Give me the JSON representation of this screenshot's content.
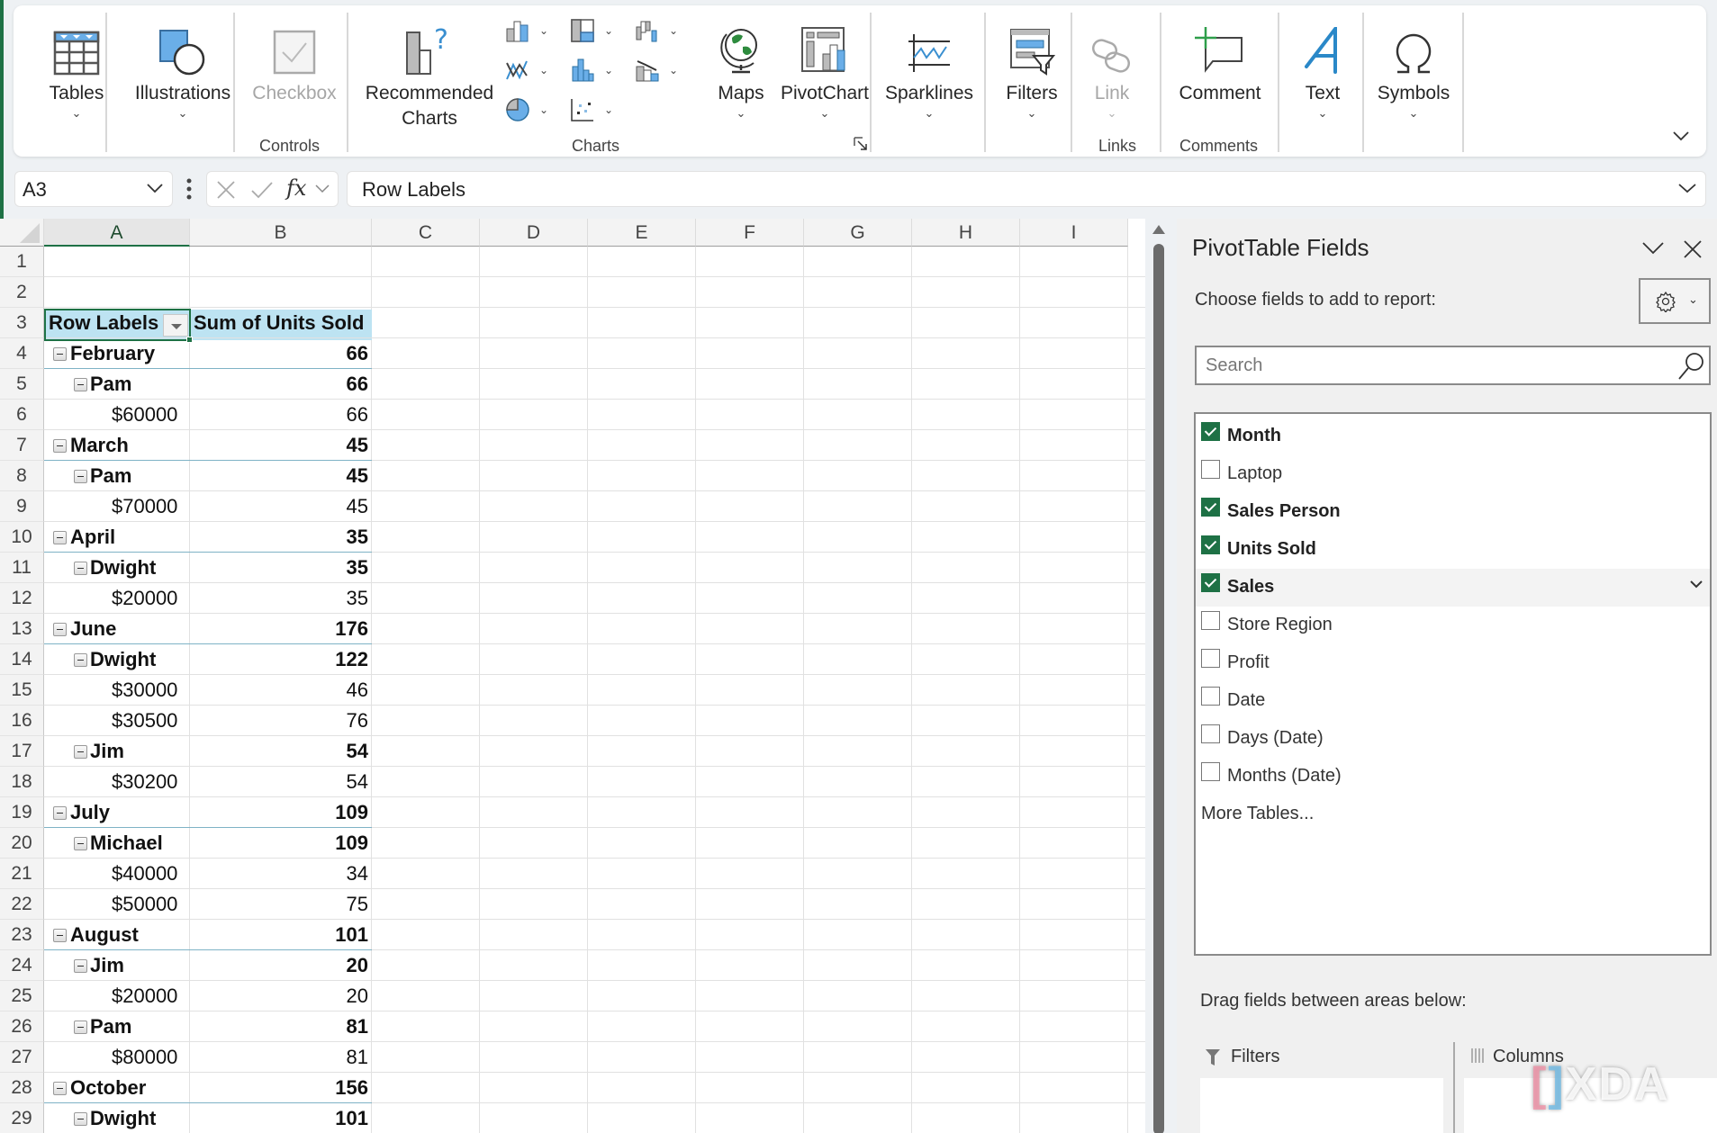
{
  "ribbon": {
    "buttons": {
      "tables": "Tables",
      "illustrations": "Illustrations",
      "checkbox": "Checkbox",
      "recommended_charts_line1": "Recommended",
      "recommended_charts_line2": "Charts",
      "maps": "Maps",
      "pivotchart": "PivotChart",
      "sparklines": "Sparklines",
      "filters": "Filters",
      "link": "Link",
      "comment": "Comment",
      "text": "Text",
      "symbols": "Symbols"
    },
    "groups": {
      "controls": "Controls",
      "charts": "Charts",
      "links": "Links",
      "comments": "Comments"
    }
  },
  "formula_bar": {
    "name_box": "A3",
    "formula": "Row Labels",
    "fx": "fx"
  },
  "sheet": {
    "columns": [
      "A",
      "B",
      "C",
      "D",
      "E",
      "F",
      "G",
      "H",
      "I"
    ],
    "selected_column": "A",
    "rows": [
      {
        "n": "1",
        "label": "",
        "value": "",
        "level": -1
      },
      {
        "n": "2",
        "label": "",
        "value": "",
        "level": -1
      },
      {
        "n": "3",
        "label": "Row Labels",
        "value": "Sum of Units Sold",
        "level": -2
      },
      {
        "n": "4",
        "label": "February",
        "value": "66",
        "level": 0
      },
      {
        "n": "5",
        "label": "Pam",
        "value": "66",
        "level": 1
      },
      {
        "n": "6",
        "label": "$60000",
        "value": "66",
        "level": 2
      },
      {
        "n": "7",
        "label": "March",
        "value": "45",
        "level": 0
      },
      {
        "n": "8",
        "label": "Pam",
        "value": "45",
        "level": 1
      },
      {
        "n": "9",
        "label": "$70000",
        "value": "45",
        "level": 2
      },
      {
        "n": "10",
        "label": "April",
        "value": "35",
        "level": 0
      },
      {
        "n": "11",
        "label": "Dwight",
        "value": "35",
        "level": 1
      },
      {
        "n": "12",
        "label": "$20000",
        "value": "35",
        "level": 2
      },
      {
        "n": "13",
        "label": "June",
        "value": "176",
        "level": 0
      },
      {
        "n": "14",
        "label": "Dwight",
        "value": "122",
        "level": 1
      },
      {
        "n": "15",
        "label": "$30000",
        "value": "46",
        "level": 2
      },
      {
        "n": "16",
        "label": "$30500",
        "value": "76",
        "level": 2
      },
      {
        "n": "17",
        "label": "Jim",
        "value": "54",
        "level": 1
      },
      {
        "n": "18",
        "label": "$30200",
        "value": "54",
        "level": 2
      },
      {
        "n": "19",
        "label": "July",
        "value": "109",
        "level": 0
      },
      {
        "n": "20",
        "label": "Michael",
        "value": "109",
        "level": 1
      },
      {
        "n": "21",
        "label": "$40000",
        "value": "34",
        "level": 2
      },
      {
        "n": "22",
        "label": "$50000",
        "value": "75",
        "level": 2
      },
      {
        "n": "23",
        "label": "August",
        "value": "101",
        "level": 0
      },
      {
        "n": "24",
        "label": "Jim",
        "value": "20",
        "level": 1
      },
      {
        "n": "25",
        "label": "$20000",
        "value": "20",
        "level": 2
      },
      {
        "n": "26",
        "label": "Pam",
        "value": "81",
        "level": 1
      },
      {
        "n": "27",
        "label": "$80000",
        "value": "81",
        "level": 2
      },
      {
        "n": "28",
        "label": "October",
        "value": "156",
        "level": 0
      },
      {
        "n": "29",
        "label": "Dwight",
        "value": "101",
        "level": 1
      }
    ]
  },
  "pane": {
    "title": "PivotTable Fields",
    "choose_label": "Choose fields to add to report:",
    "search_placeholder": "Search",
    "fields": [
      {
        "name": "Month",
        "checked": true
      },
      {
        "name": "Laptop",
        "checked": false
      },
      {
        "name": "Sales Person",
        "checked": true
      },
      {
        "name": "Units Sold",
        "checked": true
      },
      {
        "name": "Sales",
        "checked": true,
        "hovered": true
      },
      {
        "name": "Store Region",
        "checked": false
      },
      {
        "name": "Profit",
        "checked": false
      },
      {
        "name": "Date",
        "checked": false
      },
      {
        "name": "Days (Date)",
        "checked": false
      },
      {
        "name": "Months (Date)",
        "checked": false
      }
    ],
    "more_tables": "More Tables...",
    "drag_label": "Drag fields between areas below:",
    "areas": {
      "filters": "Filters",
      "columns": "Columns"
    }
  },
  "watermark": "XDA",
  "colors": {
    "accent_green": "#1e7145",
    "pivot_header_fill": "#bde3f2"
  }
}
